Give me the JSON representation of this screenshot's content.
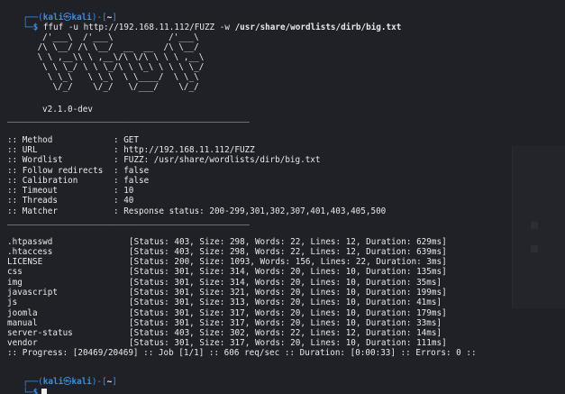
{
  "prompt": {
    "open": "┌──(",
    "user": "kali",
    "at": "㉿",
    "host": "kali",
    "close": ")-[",
    "dir": "~",
    "end": "]",
    "second": "└─",
    "dollar": "$"
  },
  "command": {
    "program": "ffuf",
    "flag_u": "-u",
    "url": "http://192.168.11.112/FUZZ",
    "flag_w": "-w",
    "wordlist": "/usr/share/wordlists/dirb/big.txt"
  },
  "banner": [
    "       /'___\\  /'___\\           /'___\\",
    "      /\\ \\__/ /\\ \\__/  __  __  /\\ \\__/",
    "      \\ \\ ,__\\\\ \\ ,__\\/\\ \\/\\ \\ \\ \\ ,__\\",
    "       \\ \\ \\_/ \\ \\ \\_/\\ \\ \\_\\ \\ \\ \\ \\_/",
    "        \\ \\_\\   \\ \\_\\  \\ \\____/  \\ \\_\\",
    "         \\/_/    \\/_/   \\/___/    \\/_/"
  ],
  "version": "v2.1.0-dev",
  "divider": "________________________________________________",
  "settings": [
    {
      "key": "Method",
      "value": "GET"
    },
    {
      "key": "URL",
      "value": "http://192.168.11.112/FUZZ"
    },
    {
      "key": "Wordlist",
      "value": "FUZZ: /usr/share/wordlists/dirb/big.txt"
    },
    {
      "key": "Follow redirects",
      "value": "false"
    },
    {
      "key": "Calibration",
      "value": "false"
    },
    {
      "key": "Timeout",
      "value": "10"
    },
    {
      "key": "Threads",
      "value": "40"
    },
    {
      "key": "Matcher",
      "value": "Response status: 200-299,301,302,307,401,403,405,500"
    }
  ],
  "results": [
    {
      "path": ".htpasswd",
      "status": "403",
      "size": "298",
      "words": "22",
      "lines": "12",
      "duration": "629ms"
    },
    {
      "path": ".htaccess",
      "status": "403",
      "size": "298",
      "words": "22",
      "lines": "12",
      "duration": "639ms"
    },
    {
      "path": "LICENSE",
      "status": "200",
      "size": "1093",
      "words": "156",
      "lines": "22",
      "duration": "3ms"
    },
    {
      "path": "css",
      "status": "301",
      "size": "314",
      "words": "20",
      "lines": "10",
      "duration": "135ms"
    },
    {
      "path": "img",
      "status": "301",
      "size": "314",
      "words": "20",
      "lines": "10",
      "duration": "35ms"
    },
    {
      "path": "javascript",
      "status": "301",
      "size": "321",
      "words": "20",
      "lines": "10",
      "duration": "199ms"
    },
    {
      "path": "js",
      "status": "301",
      "size": "313",
      "words": "20",
      "lines": "10",
      "duration": "41ms"
    },
    {
      "path": "joomla",
      "status": "301",
      "size": "317",
      "words": "20",
      "lines": "10",
      "duration": "179ms"
    },
    {
      "path": "manual",
      "status": "301",
      "size": "317",
      "words": "20",
      "lines": "10",
      "duration": "33ms"
    },
    {
      "path": "server-status",
      "status": "403",
      "size": "302",
      "words": "22",
      "lines": "12",
      "duration": "14ms"
    },
    {
      "path": "vendor",
      "status": "301",
      "size": "317",
      "words": "20",
      "lines": "10",
      "duration": "111ms"
    }
  ],
  "progress": ":: Progress: [20469/20469] :: Job [1/1] :: 606 req/sec :: Duration: [0:00:33] :: Errors: 0 ::",
  "colors": {
    "background": "#1f2127",
    "prompt": "#3a8ee6",
    "text": "#e9e9ea"
  }
}
